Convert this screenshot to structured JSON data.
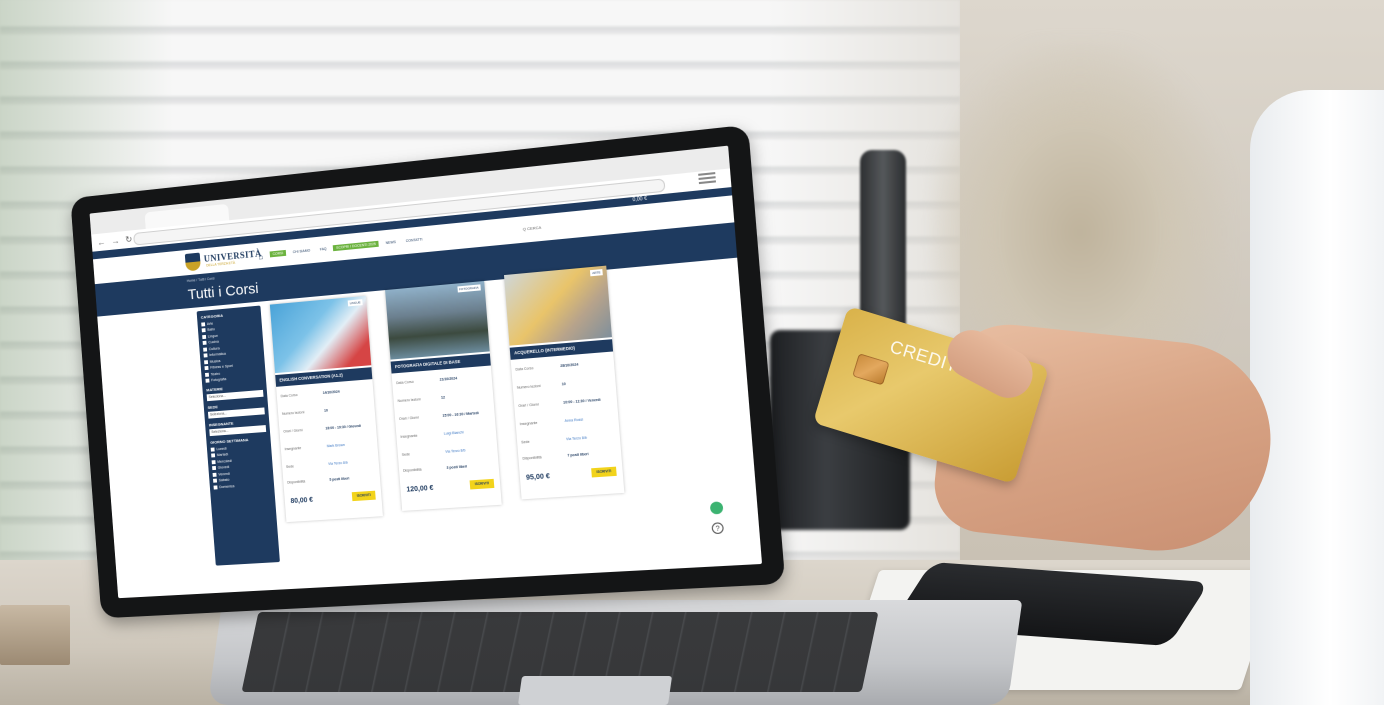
{
  "scene": {
    "credit_card_text": "CREDIT CA"
  },
  "site": {
    "logo": "UNIVERSITÀ",
    "logo_sub": "DELLA TERZA ETÀ",
    "nav": [
      "CORSI",
      "CHI SIAMO",
      "FAQ",
      "SCOPRI I DOCENTI 2025",
      "NEWS",
      "CONTATTI"
    ],
    "search": "Q CERCA",
    "topbar": "0,00 €",
    "breadcrumb": "Home / Tutti i Corsi",
    "page_title": "Tutti i Corsi"
  },
  "sidebar": {
    "categoria_label": "CATEGORIA",
    "categorie": [
      "Arte",
      "Ballo",
      "Lingue",
      "Cucina",
      "Cultura",
      "Informatica",
      "Musica",
      "Fitness e Sport",
      "Teatro",
      "Fotografia"
    ],
    "materie_label": "MATERIE",
    "materie_value": "Seleziona...",
    "sede_label": "SEDE",
    "sede_value": "Seleziona...",
    "insegnante_label": "INSEGNANTE",
    "insegnante_value": "Seleziona...",
    "giorni_label": "GIORNO SETTIMANA",
    "giorni": [
      "Lunedì",
      "Martedì",
      "Mercoledì",
      "Giovedì",
      "Venerdì",
      "Sabato",
      "Domenica"
    ]
  },
  "courses": [
    {
      "title": "ENGLISH CONVERSATION (A1.2)",
      "badge": "LINGUE",
      "rows": [
        {
          "label": "Data Corso",
          "value": "14/10/2024"
        },
        {
          "label": "Numero lezioni",
          "value": "10"
        },
        {
          "label": "Orari / Giorni",
          "value": "18:00 - 19:30 / Giovedì"
        },
        {
          "label": "Insegnante",
          "value": "Mark Brown"
        },
        {
          "label": "Sede",
          "value": "Via Terzo 8/b"
        },
        {
          "label": "Disponibilità",
          "value": "5 posti liberi"
        }
      ],
      "price": "80,00 €",
      "button": "ISCRIVITI"
    },
    {
      "title": "FOTOGRAFIA DIGITALE DI BASE",
      "badge": "FOTOGRAFIA",
      "rows": [
        {
          "label": "Data Corso",
          "value": "21/10/2024"
        },
        {
          "label": "Numero lezioni",
          "value": "12"
        },
        {
          "label": "Orari / Giorni",
          "value": "15:00 - 16:30 / Martedì"
        },
        {
          "label": "Insegnante",
          "value": "Luigi Bianchi"
        },
        {
          "label": "Sede",
          "value": "Via Terzo 8/b"
        },
        {
          "label": "Disponibilità",
          "value": "3 posti liberi"
        }
      ],
      "price": "120,00 €",
      "button": "ISCRIVITI"
    },
    {
      "title": "ACQUERELLO (INTERMEDIO)",
      "badge": "ARTE",
      "rows": [
        {
          "label": "Data Corso",
          "value": "28/10/2024"
        },
        {
          "label": "Numero lezioni",
          "value": "10"
        },
        {
          "label": "Orari / Giorni",
          "value": "10:00 - 11:30 / Venerdì"
        },
        {
          "label": "Insegnante",
          "value": "Anna Rossi"
        },
        {
          "label": "Sede",
          "value": "Via Terzo 8/b"
        },
        {
          "label": "Disponibilità",
          "value": "7 posti liberi"
        }
      ],
      "price": "95,00 €",
      "button": "ISCRIVITI"
    }
  ]
}
